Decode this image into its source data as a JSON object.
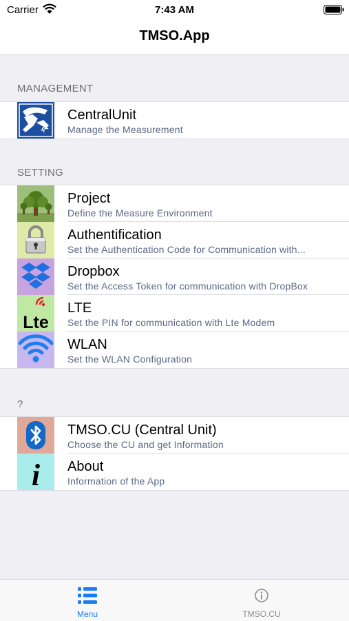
{
  "status_bar": {
    "carrier": "Carrier",
    "time": "7:43 AM"
  },
  "nav": {
    "title": "TMSO.App"
  },
  "sections": {
    "management": {
      "header": "MANAGEMENT",
      "rows": [
        {
          "title": "CentralUnit",
          "subtitle": "Manage the Measurement",
          "icon": "measurement-icon"
        }
      ]
    },
    "setting": {
      "header": "SETTING",
      "rows": [
        {
          "title": "Project",
          "subtitle": "Define the Measure Environment",
          "icon": "tree-icon"
        },
        {
          "title": "Authentification",
          "subtitle": "Set the Authentication Code for Communication with...",
          "icon": "padlock-icon"
        },
        {
          "title": "Dropbox",
          "subtitle": "Set the Access Token for communication with DropBox",
          "icon": "dropbox-icon"
        },
        {
          "title": "LTE",
          "subtitle": "Set the PIN for communication with Lte Modem",
          "icon": "lte-icon",
          "icon_text": "Lte"
        },
        {
          "title": "WLAN",
          "subtitle": "Set the WLAN Configuration",
          "icon": "wifi-icon"
        }
      ]
    },
    "other": {
      "header": "?",
      "rows": [
        {
          "title": "TMSO.CU (Central Unit)",
          "subtitle": "Choose the CU and get Information",
          "icon": "bluetooth-icon"
        },
        {
          "title": "About",
          "subtitle": "Information of the App",
          "icon": "info-icon",
          "icon_text": "i"
        }
      ]
    }
  },
  "tab_bar": {
    "tabs": [
      {
        "label": "Menu",
        "icon": "list-icon",
        "selected": true
      },
      {
        "label": "TMSO.CU",
        "icon": "info-circle-icon",
        "selected": false
      }
    ]
  },
  "colors": {
    "tab_selected": "#1a7cf5",
    "tab_unselected": "#8e8e93",
    "subtitle": "#5b6785",
    "background": "#efeff4"
  }
}
